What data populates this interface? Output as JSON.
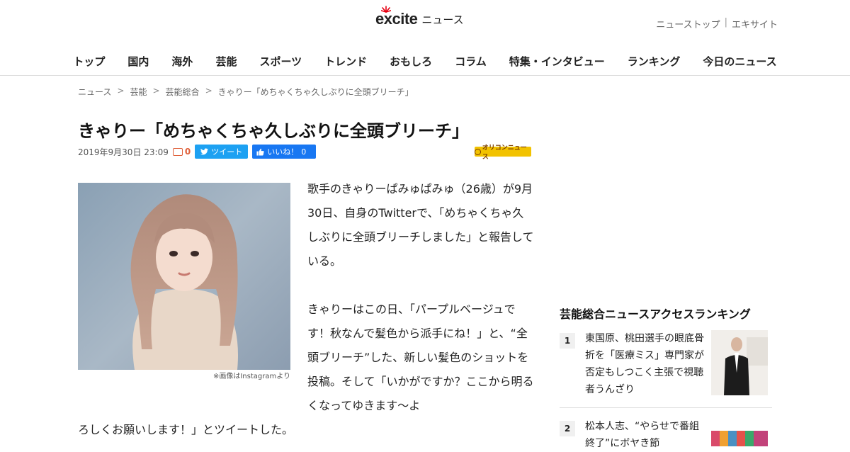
{
  "header": {
    "logo_text": "excite",
    "logo_suffix": "ニュース",
    "toplinks": [
      "ニューストップ",
      "エキサイト"
    ],
    "toplinks_sep": "|"
  },
  "nav": [
    "トップ",
    "国内",
    "海外",
    "芸能",
    "スポーツ",
    "トレンド",
    "おもしろ",
    "コラム",
    "特集・インタビュー",
    "ランキング",
    "今日のニュース"
  ],
  "breadcrumb": [
    "ニュース",
    "芸能",
    "芸能総合",
    "きゃりー「めちゃくちゃ久しぶりに全頭ブリーチ」"
  ],
  "breadcrumb_sep": ">",
  "article": {
    "title": "きゃりー「めちゃくちゃ久しぶりに全頭ブリーチ」",
    "date": "2019年9月30日 23:09",
    "comment_count": "0",
    "tweet_label": "ツイート",
    "like_label": "いいね！",
    "like_count": "0",
    "source_badge": "オリコンニュース",
    "photo_caption": "※画像はInstagramより",
    "paragraph1": "歌手のきゃりーぱみゅぱみゅ（26歳）が9月30日、自身のTwitterで、「めちゃくちゃ久しぶりに全頭ブリーチしました」と報告している。",
    "paragraph2": "きゃりーはこの日、「パープルベージュです！秋なんで髪色から派手にね！」と、“全頭ブリーチ”した、新しい髪色のショットを投稿。そして「いかがですか？ここから明るくなってゆきます～よ",
    "paragraph2_tail": "ろしくお願いします！」とツイートした。"
  },
  "ranking": {
    "title": "芸能総合ニュースアクセスランキング",
    "items": [
      {
        "num": "1",
        "text": "東国原、桃田選手の眼底骨折を「医療ミス」専門家が否定もしつこく主張で視聴者うんざり"
      },
      {
        "num": "2",
        "text": "松本人志、“やらせで番組終了”にボヤき節"
      }
    ]
  },
  "colors": {
    "tweet": "#1da1f2",
    "like": "#1877f2",
    "comment": "#e0603a",
    "badge": "#f2c200"
  }
}
